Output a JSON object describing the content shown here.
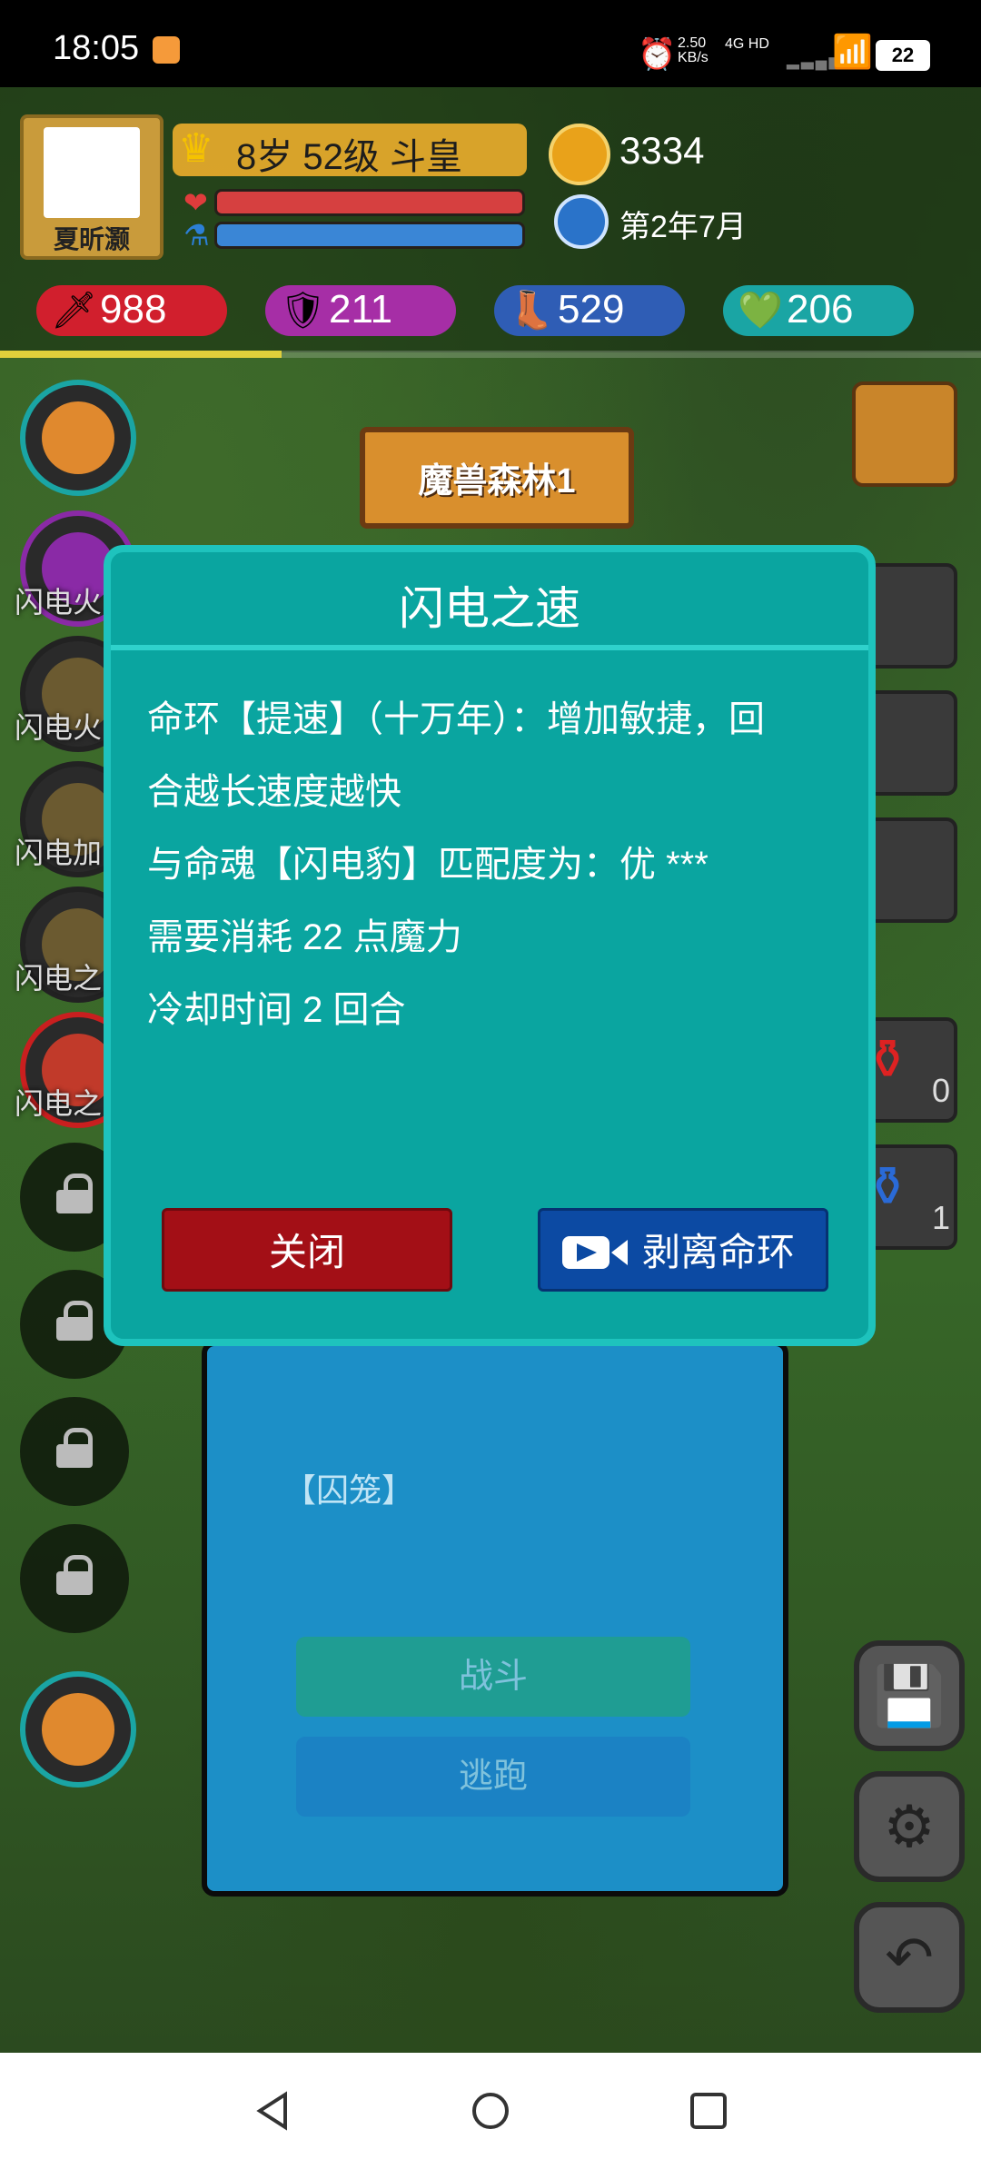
{
  "status_bar": {
    "time": "18:05",
    "net_speed": "2.50",
    "net_unit": "KB/s",
    "network": "4G HD",
    "battery": "22"
  },
  "player": {
    "name": "夏昕灏",
    "level": "8岁 52级 斗皇",
    "gold": "3334",
    "date": "第2年7月",
    "hp_fraction": 1.0,
    "mp_fraction": 1.0,
    "exp_fraction": 0.29
  },
  "stats": {
    "attack": "988",
    "defense": "211",
    "speed": "529",
    "health": "206"
  },
  "map_sign": "魔兽森林1",
  "left_labels": [
    "闪电火",
    "闪电火",
    "闪电加",
    "闪电之",
    "闪电之"
  ],
  "potions": {
    "red_count": "0",
    "blue_count": "1"
  },
  "battle": {
    "status": "【囚笼】",
    "fight": "战斗",
    "flee": "逃跑"
  },
  "dialog": {
    "title": "闪电之速",
    "line1": "命环【提速】（十万年）：增加敏捷，回",
    "line2": "合越长速度越快",
    "line3": "与命魂【闪电豹】匹配度为：优 ***",
    "line4": "需要消耗 22 点魔力",
    "line5": "冷却时间 2 回合",
    "close_label": "关闭",
    "strip_label": "剥离命环"
  },
  "icons": {
    "crown": "crown-icon",
    "coin": "coin-icon",
    "clock": "clock-icon",
    "video": "video-icon"
  },
  "colors": {
    "dialog_bg": "#0aa5a0",
    "close_btn": "#a30f16",
    "strip_btn": "#0c4aa3"
  }
}
